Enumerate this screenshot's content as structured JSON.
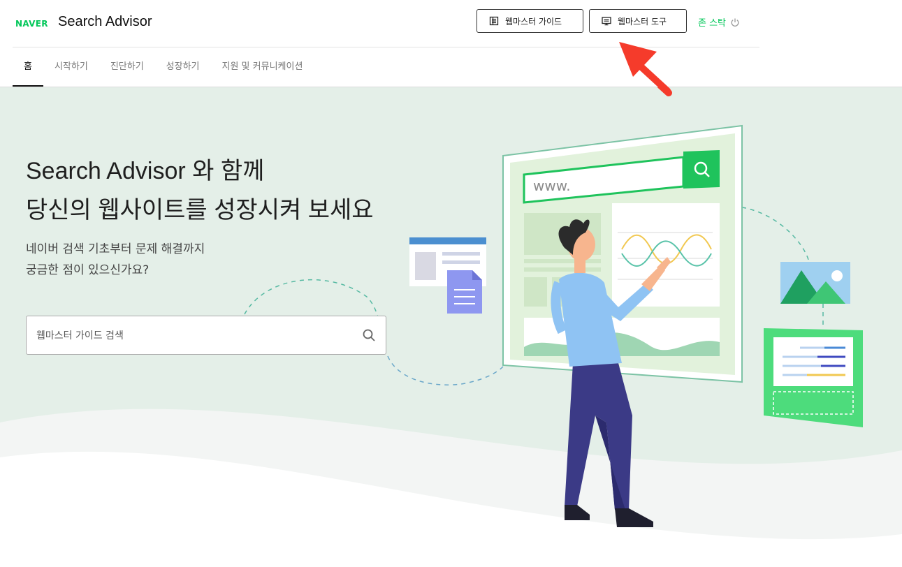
{
  "header": {
    "logo_text": "NAVER",
    "brand_title": "Search Advisor",
    "guide_button_label": "웹마스터 가이드",
    "tools_button_label": "웹마스터 도구",
    "user_name": "존 스탁",
    "icons": {
      "guide": "book-icon",
      "tools": "monitor-icon",
      "logout": "power-icon"
    }
  },
  "nav": {
    "items": [
      {
        "label": "홈",
        "active": true
      },
      {
        "label": "시작하기",
        "active": false
      },
      {
        "label": "진단하기",
        "active": false
      },
      {
        "label": "성장하기",
        "active": false
      },
      {
        "label": "지원 및 커뮤니케이션",
        "active": false
      }
    ]
  },
  "hero": {
    "headline_line1": "Search Advisor 와 함께",
    "headline_line2": "당신의 웹사이트를 성장시켜 보세요",
    "sub_line1": "네이버 검색 기초부터 문제 해결까지",
    "sub_line2": "궁금한 점이 있으신가요?",
    "search_placeholder": "웹마스터 가이드 검색",
    "illustration_url_text": "www."
  },
  "colors": {
    "brand_green": "#03c75a",
    "hero_background": "#e4efe8",
    "annotation_arrow": "#f53b2b"
  }
}
